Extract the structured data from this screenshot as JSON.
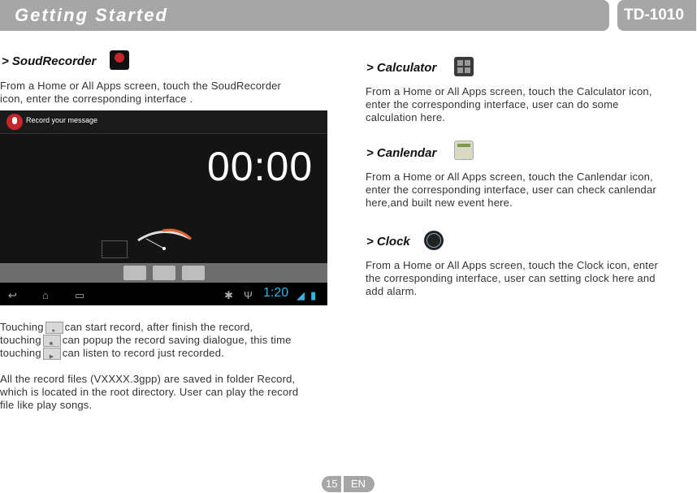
{
  "header": {
    "title": "Getting Started",
    "model": "TD-1010"
  },
  "left": {
    "recorder_heading": "> SoudRecorder",
    "recorder_desc_1": "From a Home or All Apps screen, touch the SoudRecorder",
    "recorder_desc_2": "icon, enter the corresponding interface .",
    "screenshot": {
      "title_bar": "Record your message",
      "timer": "00:00",
      "status_time": "1:20"
    },
    "touch_1a": "Touching",
    "touch_1b": "can start record, after finish the record,",
    "touch_2a": "touching",
    "touch_2b": "can popup the record saving dialogue, this time",
    "touch_3a": "touching",
    "touch_3b": "can listen to record just recorded.",
    "files_1": "All the record files (VXXXX.3gpp) are saved in folder Record,",
    "files_2": "which is located in the root directory. User can play the record",
    "files_3": "file like play songs."
  },
  "right": {
    "calc_heading": "> Calculator",
    "calc_1": "From a Home or All Apps screen, touch the Calculator icon,",
    "calc_2": "enter the corresponding interface, user can do some",
    "calc_3": "calculation here.",
    "cal_heading": "> Canlendar",
    "cal_1": "From a Home or All Apps screen, touch the Canlendar icon,",
    "cal_2": "enter the corresponding interface, user can check canlendar",
    "cal_3": "here,and built new event here.",
    "clock_heading": "> Clock",
    "clock_1": "From a Home or All Apps screen, touch the Clock icon, enter",
    "clock_2": "the corresponding interface, user can setting clock here and",
    "clock_3": "add alarm."
  },
  "footer": {
    "page": "15",
    "lang": "EN"
  },
  "colors": {
    "header_gray": "#a6a6a6",
    "record_red": "#c4262e",
    "android_blue": "#31b5e5"
  },
  "icons": [
    "sound-recorder-icon",
    "calculator-icon",
    "calendar-icon",
    "clock-icon",
    "microphone-icon"
  ]
}
